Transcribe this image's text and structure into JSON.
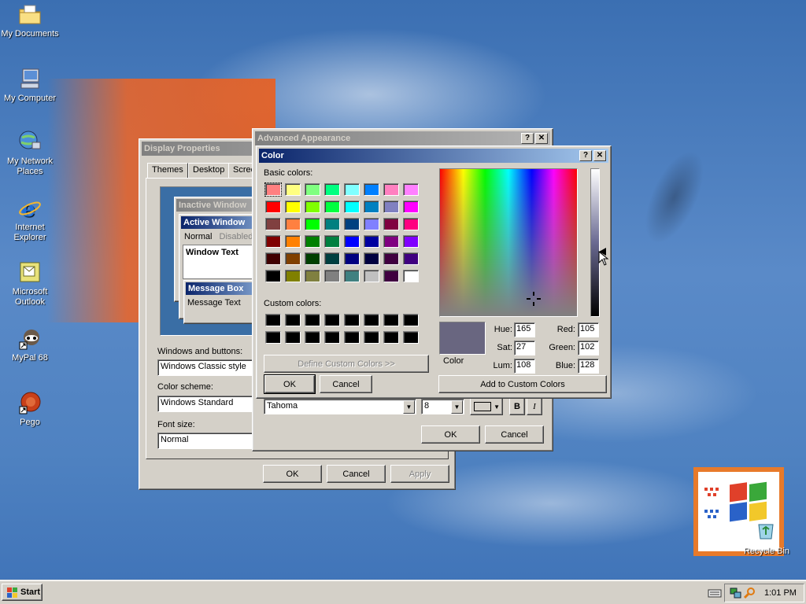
{
  "desktop": {
    "icons": [
      {
        "label": "My Documents",
        "icon": "my-documents-icon"
      },
      {
        "label": "My Computer",
        "icon": "my-computer-icon"
      },
      {
        "label": "My Network Places",
        "icon": "network-places-icon"
      },
      {
        "label": "Internet Explorer",
        "icon": "internet-explorer-icon"
      },
      {
        "label": "Microsoft Outlook",
        "icon": "outlook-icon"
      },
      {
        "label": "MyPal 68",
        "icon": "mypal-icon"
      },
      {
        "label": "Pego",
        "icon": "pego-icon"
      },
      {
        "label": "Recycle Bin",
        "icon": "recycle-bin-icon"
      }
    ]
  },
  "display_properties": {
    "title": "Display Properties",
    "tabs": [
      "Themes",
      "Desktop",
      "Scree"
    ],
    "preview": {
      "inactive_window": "Inactive Window",
      "active_window": "Active Window",
      "menu_normal": "Normal",
      "menu_disabled": "Disabled",
      "window_text": "Window Text",
      "message_box": "Message Box",
      "message_text": "Message Text"
    },
    "windows_buttons_label": "Windows and buttons:",
    "windows_buttons_value": "Windows Classic style",
    "color_scheme_label": "Color scheme:",
    "color_scheme_value": "Windows Standard",
    "font_size_label": "Font size:",
    "font_size_value": "Normal",
    "ok": "OK",
    "cancel": "Cancel",
    "apply": "Apply"
  },
  "advanced_appearance": {
    "title": "Advanced Appearance",
    "font_value": "Tahoma",
    "size_value": "8",
    "bold": "B",
    "italic": "I",
    "ok": "OK",
    "cancel": "Cancel"
  },
  "color_dialog": {
    "title": "Color",
    "basic_colors_label": "Basic colors:",
    "custom_colors_label": "Custom colors:",
    "define_custom": "Define Custom Colors >>",
    "ok": "OK",
    "cancel": "Cancel",
    "color_label": "Color",
    "hue_label": "Hue:",
    "hue": "165",
    "sat_label": "Sat:",
    "sat": "27",
    "lum_label": "Lum:",
    "lum": "108",
    "red_label": "Red:",
    "red": "105",
    "green_label": "Green:",
    "green": "102",
    "blue_label": "Blue:",
    "blue": "128",
    "add_custom": "Add to Custom Colors",
    "current_color": "#696680",
    "basic_colors": [
      [
        "#ff8080",
        "#ffff80",
        "#80ff80",
        "#00ff80",
        "#80ffff",
        "#0080ff",
        "#ff80c0",
        "#ff80ff"
      ],
      [
        "#ff0000",
        "#ffff00",
        "#80ff00",
        "#00ff40",
        "#00ffff",
        "#0080c0",
        "#8080c0",
        "#ff00ff"
      ],
      [
        "#804040",
        "#ff8040",
        "#00ff00",
        "#008080",
        "#004080",
        "#8080ff",
        "#800040",
        "#ff0080"
      ],
      [
        "#800000",
        "#ff8000",
        "#008000",
        "#008040",
        "#0000ff",
        "#0000a0",
        "#800080",
        "#8000ff"
      ],
      [
        "#400000",
        "#804000",
        "#004000",
        "#004040",
        "#000080",
        "#000040",
        "#400040",
        "#400080"
      ],
      [
        "#000000",
        "#808000",
        "#808040",
        "#808080",
        "#408080",
        "#c0c0c0",
        "#400040",
        "#ffffff"
      ]
    ],
    "custom_colors": 16
  },
  "taskbar": {
    "start": "Start",
    "time": "1:01 PM"
  }
}
